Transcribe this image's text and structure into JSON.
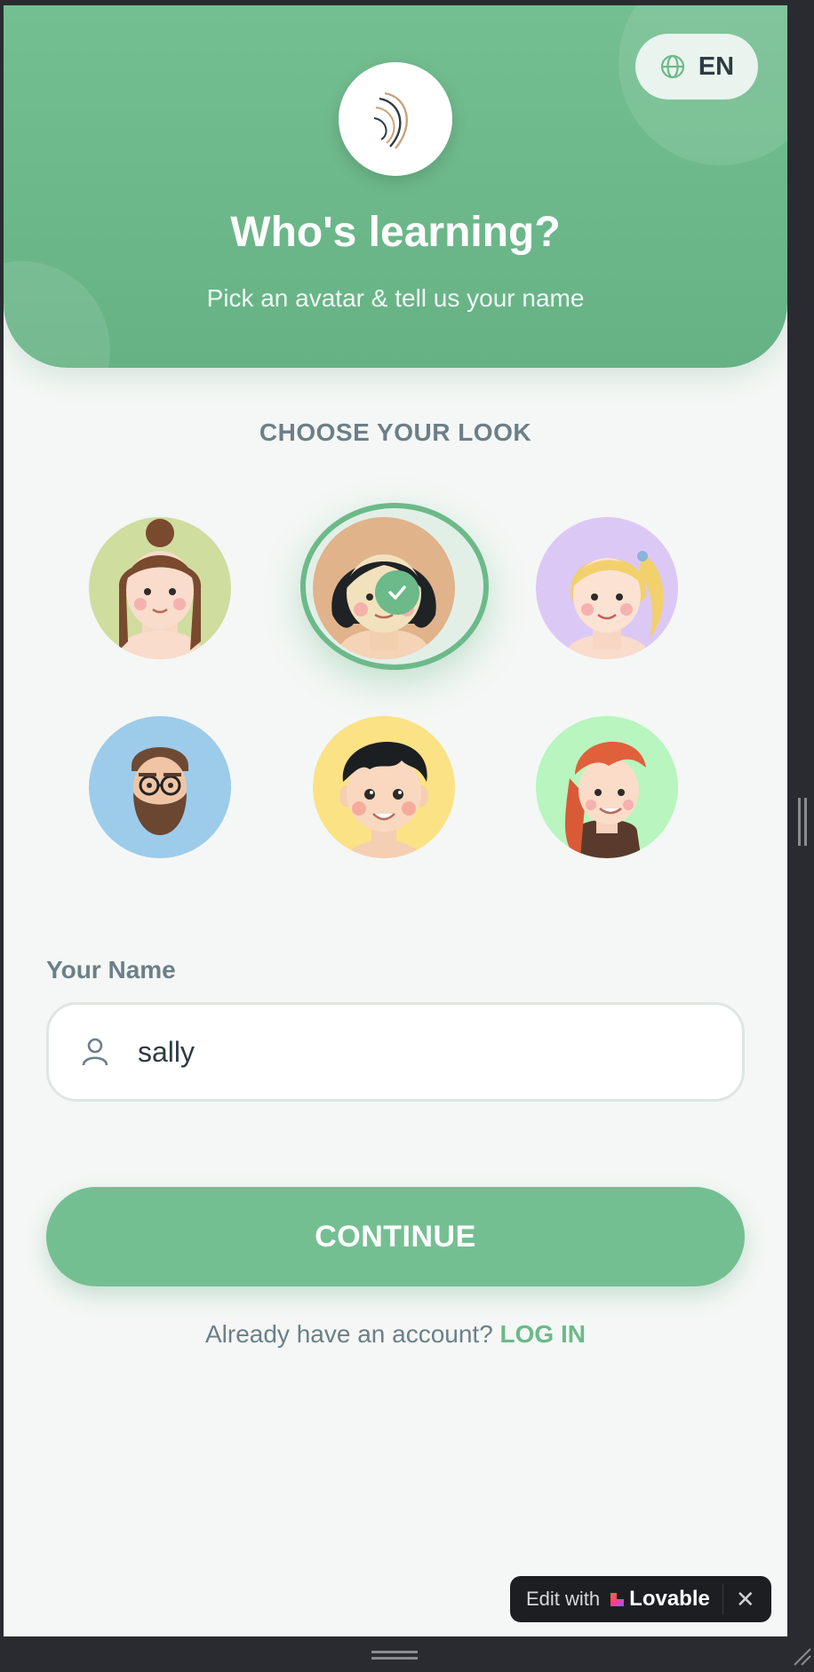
{
  "header": {
    "title": "Who's learning?",
    "subtitle": "Pick an avatar & tell us your name",
    "language": {
      "icon": "globe-icon",
      "label": "EN"
    },
    "logo_icon": "swirl-logo-icon"
  },
  "avatar_picker": {
    "label": "CHOOSE YOUR LOOK",
    "selected_index": 1,
    "avatars": [
      {
        "name": "girl-brown-bun",
        "bg": "#cfdd9f"
      },
      {
        "name": "girl-black-bob",
        "bg": "#e0b38a"
      },
      {
        "name": "girl-blonde-ponytail",
        "bg": "#dcc8f5"
      },
      {
        "name": "man-beard-glasses",
        "bg": "#9cccea"
      },
      {
        "name": "boy-black-hair",
        "bg": "#fbe285"
      },
      {
        "name": "girl-red-hair",
        "bg": "#b8f5bf"
      }
    ]
  },
  "name_form": {
    "label": "Your Name",
    "value": "sally",
    "icon": "user-icon"
  },
  "actions": {
    "continue_label": "CONTINUE",
    "login_prompt": "Already have an account?",
    "login_link": "LOG IN"
  },
  "lovable_badge": {
    "edit_text": "Edit with",
    "brand": "Lovable",
    "close": "✕"
  },
  "colors": {
    "primary": "#74bf91",
    "text_muted": "#6c7f88",
    "text_dark": "#2d3b42",
    "background": "#f4f7f5"
  }
}
